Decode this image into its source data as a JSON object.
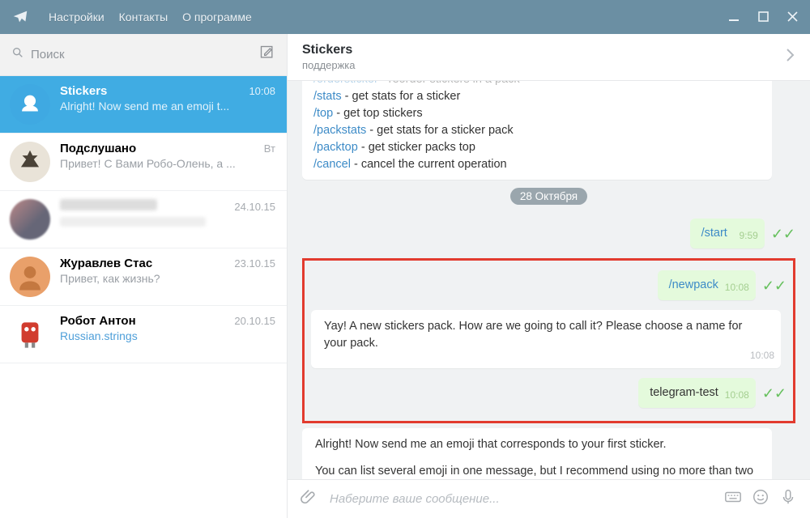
{
  "menu": {
    "settings": "Настройки",
    "contacts": "Контакты",
    "about": "О программе"
  },
  "search": {
    "placeholder": "Поиск"
  },
  "chats": [
    {
      "name": "Stickers",
      "time": "10:08",
      "preview": "Alright! Now send me an emoji t..."
    },
    {
      "name": "Подслушано",
      "time": "Вт",
      "preview": "Привет! С Вами Робо-Олень, а ..."
    },
    {
      "name": "",
      "time": "24.10.15",
      "preview": ""
    },
    {
      "name": "Журавлев Стас",
      "time": "23.10.15",
      "preview": "Привет, как жизнь?"
    },
    {
      "name": "Робот Антон",
      "time": "20.10.15",
      "preview": "Russian.strings"
    }
  ],
  "header": {
    "title": "Stickers",
    "subtitle": "поддержка"
  },
  "helpBlock": {
    "lines": [
      {
        "cmd": "/ordersticker",
        "desc": " - reorder stickers in a pack",
        "cut": true
      },
      {
        "cmd": "/stats",
        "desc": " - get stats for a sticker"
      },
      {
        "cmd": "/top",
        "desc": " - get top stickers"
      },
      {
        "cmd": "/packstats",
        "desc": " - get stats for a sticker pack"
      },
      {
        "cmd": "/packtop",
        "desc": " - get sticker packs top"
      },
      {
        "cmd": "/cancel",
        "desc": " - cancel the current operation"
      }
    ]
  },
  "dateBadge": "28 Октября",
  "m1": {
    "text": "/start",
    "time": "9:59"
  },
  "m2": {
    "text": "/newpack",
    "time": "10:08"
  },
  "m3": {
    "text": "Yay! A new stickers pack. How are we going to call it? Please choose a name for your pack.",
    "time": "10:08"
  },
  "m4": {
    "text": "telegram-test",
    "time": "10:08"
  },
  "m5": {
    "line1": "Alright! Now send me an emoji that corresponds to your first sticker.",
    "line2": "You can list several emoji in one message, but I recommend using no more than two per sticker."
  },
  "composer": {
    "placeholder": "Наберите ваше сообщение..."
  }
}
